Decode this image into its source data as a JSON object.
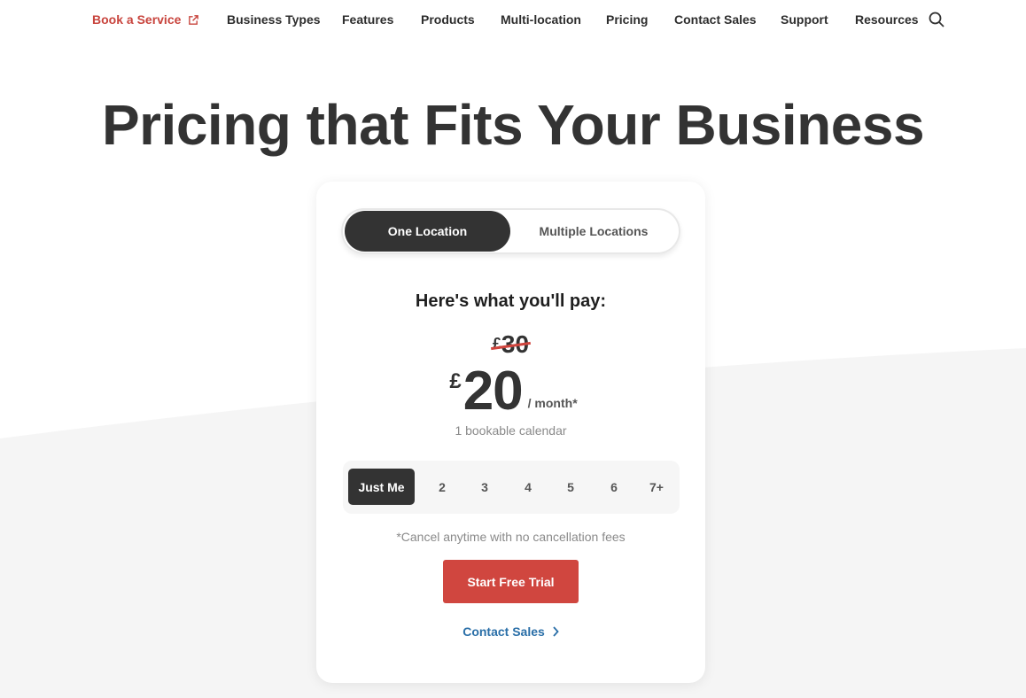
{
  "nav": {
    "book_service": "Book a Service",
    "items": [
      "Business Types",
      "Features",
      "Products",
      "Multi-location",
      "Pricing",
      "Contact Sales",
      "Support",
      "Resources"
    ]
  },
  "hero": {
    "title": "Pricing that Fits Your Business"
  },
  "card": {
    "toggle": {
      "one_location": "One Location",
      "multiple_locations": "Multiple Locations",
      "selected": "One Location"
    },
    "pay_heading": "Here's what you'll pay:",
    "currency": "£",
    "old_price": "30",
    "price": "20",
    "per_month": "/ month*",
    "calendar_note": "1 bookable calendar",
    "staff_options": [
      "Just Me",
      "2",
      "3",
      "4",
      "5",
      "6",
      "7+"
    ],
    "staff_selected": "Just Me",
    "cancel_note": "*Cancel anytime with no cancellation fees",
    "cta": "Start Free Trial",
    "contact_link": "Contact Sales"
  },
  "colors": {
    "brand_red": "#d0463f",
    "dark": "#333333",
    "link_blue": "#2a6fa8"
  },
  "icons": {
    "book_service": "external-link-icon",
    "search": "search-icon",
    "contact": "chevron-right-icon"
  }
}
